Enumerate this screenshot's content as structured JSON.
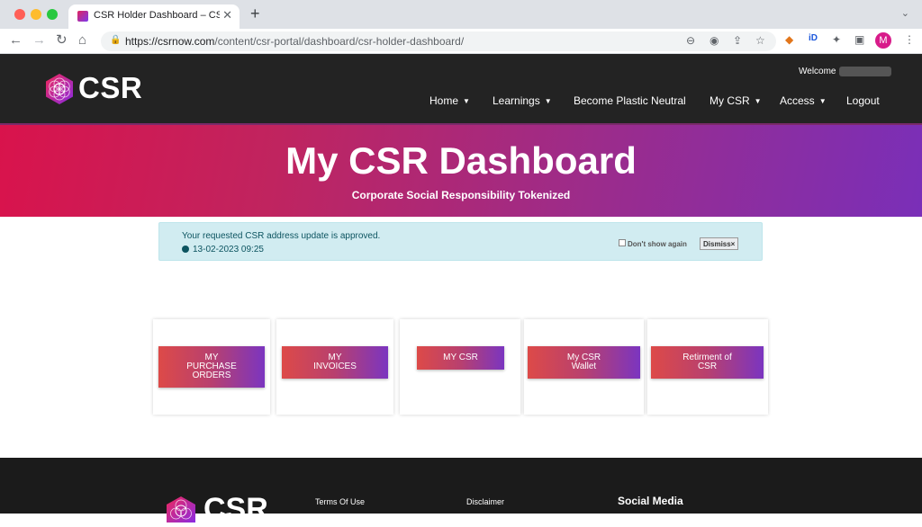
{
  "browser": {
    "tab_title": "CSR Holder Dashboard – CSRnow",
    "tab_close": "✕",
    "new_tab": "+",
    "url_host": "https://csrnow.com",
    "url_path": "/content/csr-portal/dashboard/csr-holder-dashboard/",
    "avatar_letter": "M"
  },
  "header": {
    "logo_text": "CSR",
    "welcome": "Welcome",
    "nav": [
      {
        "label": "Home",
        "dropdown": true
      },
      {
        "label": "Learnings",
        "dropdown": true
      },
      {
        "label": "Become Plastic Neutral",
        "dropdown": false
      },
      {
        "label": "My CSR",
        "dropdown": true
      },
      {
        "label": "Access",
        "dropdown": true
      },
      {
        "label": "Logout",
        "dropdown": false
      }
    ]
  },
  "hero": {
    "title": "My CSR Dashboard",
    "subtitle": "Corporate Social Responsibility Tokenized"
  },
  "alert": {
    "message": "Your requested CSR address update is approved.",
    "timestamp": "13-02-2023 09:25",
    "dont_show": "Don't show again",
    "dismiss": "Dismiss×"
  },
  "cards": [
    {
      "label": "MY\nPURCHASE\nORDERS"
    },
    {
      "label": "MY\nINVOICES"
    },
    {
      "label": "MY CSR"
    },
    {
      "label": "My CSR\nWallet"
    },
    {
      "label": "Retirment of\nCSR"
    }
  ],
  "footer": {
    "logo_text": "CSR",
    "terms": "Terms Of Use",
    "disclaimer": "Disclaimer",
    "social_heading": "Social Media"
  },
  "colors": {
    "hero_start": "#d9134c",
    "hero_end": "#7a2fb8",
    "header_bg": "#232323",
    "alert_bg": "#d1ecf1"
  }
}
